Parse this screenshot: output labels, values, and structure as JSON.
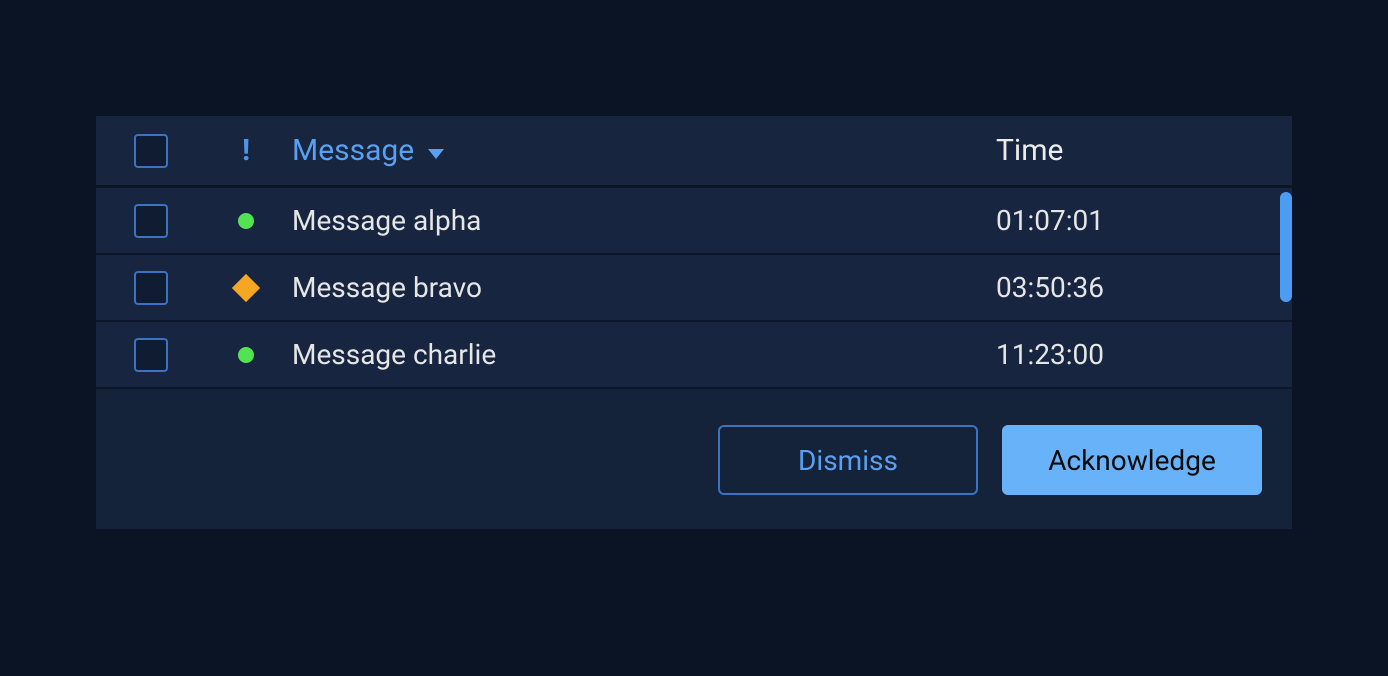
{
  "header": {
    "status_symbol": "!",
    "message_col": "Message",
    "time_col": "Time"
  },
  "rows": [
    {
      "status": "ok",
      "message": "Message alpha",
      "time": "01:07:01"
    },
    {
      "status": "warn",
      "message": "Message bravo",
      "time": "03:50:36"
    },
    {
      "status": "ok",
      "message": "Message charlie",
      "time": "11:23:00"
    }
  ],
  "footer": {
    "dismiss": "Dismiss",
    "acknowledge": "Acknowledge"
  }
}
